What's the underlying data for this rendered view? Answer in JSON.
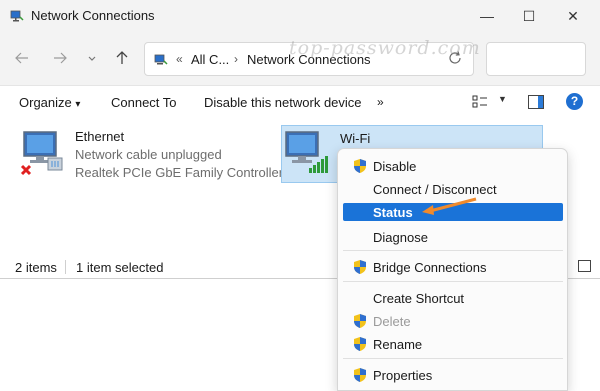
{
  "window": {
    "title": "Network Connections",
    "watermark": "top-password.com"
  },
  "titlebar": {
    "minimize_glyph": "—",
    "maximize_glyph": "☐",
    "close_glyph": "✕"
  },
  "address": {
    "overflow_label": "«",
    "crumb1": "All C...",
    "separator": "›",
    "crumb2": "Network Connections"
  },
  "toolbar": {
    "organize_label": "Organize",
    "organize_caret": "▾",
    "connect_label": "Connect To",
    "disable_label": "Disable this network device",
    "more_label": "»",
    "help_label": "?"
  },
  "connections": [
    {
      "name": "Ethernet",
      "status": "Network cable unplugged",
      "device": "Realtek PCIe GbE Family Controller",
      "icon": "ethernet-adapter-icon",
      "selected": false
    },
    {
      "name": "Wi-Fi",
      "status": "",
      "device": "",
      "icon": "wifi-adapter-icon",
      "selected": true
    }
  ],
  "statusbar": {
    "items_count": "2 items",
    "selected_count": "1 item selected"
  },
  "context_menu": {
    "items": [
      {
        "label": "Disable",
        "shield": true,
        "disabled": false,
        "selected": false
      },
      {
        "label": "Connect / Disconnect",
        "shield": false,
        "disabled": false,
        "selected": false
      },
      {
        "label": "Status",
        "shield": false,
        "disabled": false,
        "selected": true
      },
      {
        "label": "Diagnose",
        "shield": false,
        "disabled": false,
        "selected": false
      },
      {
        "label": "Bridge Connections",
        "shield": true,
        "disabled": false,
        "selected": false
      },
      {
        "label": "Create Shortcut",
        "shield": false,
        "disabled": false,
        "selected": false
      },
      {
        "label": "Delete",
        "shield": true,
        "disabled": true,
        "selected": false
      },
      {
        "label": "Rename",
        "shield": true,
        "disabled": false,
        "selected": false
      },
      {
        "label": "Properties",
        "shield": true,
        "disabled": false,
        "selected": false
      }
    ]
  },
  "colors": {
    "accent": "#1a73d8",
    "selection_bg": "#cce4f7",
    "annotation_arrow": "#f08a2c"
  }
}
